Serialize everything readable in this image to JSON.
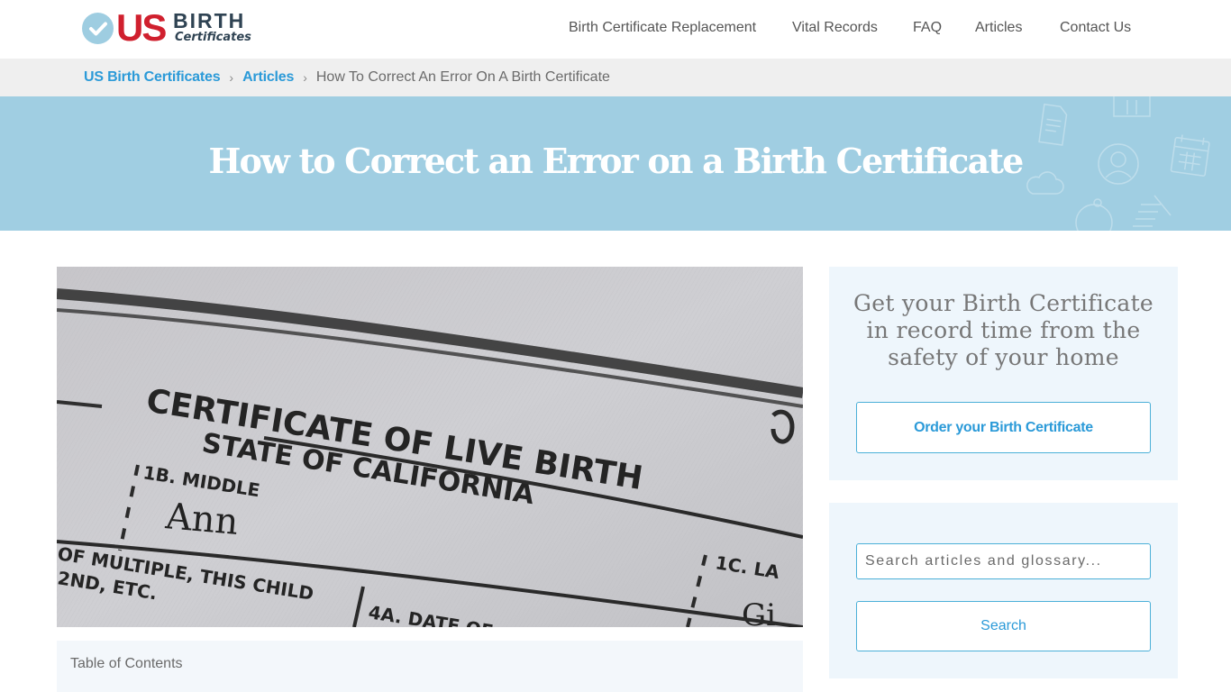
{
  "colors": {
    "brand_red": "#d0202e",
    "brand_navy": "#2f4353",
    "accent_blue": "#2b9ad8",
    "hero_bg": "#a0cee2",
    "breadcrumb_bg": "#efefef",
    "sidebar_bg": "#eef6fc"
  },
  "header": {
    "logo": {
      "mark_icon": "check-circle-icon",
      "us": "US",
      "birth": "BIRTH",
      "certificates": "Certificates"
    },
    "nav": [
      {
        "label": "Birth Certificate Replacement"
      },
      {
        "label": "Vital Records"
      },
      {
        "label": "FAQ"
      },
      {
        "label": "Articles"
      },
      {
        "label": "Contact Us"
      }
    ]
  },
  "breadcrumb": {
    "items": [
      {
        "label": "US Birth Certificates"
      },
      {
        "label": "Articles"
      }
    ],
    "separator": "›",
    "current": "How To Correct An Error On A Birth Certificate"
  },
  "hero": {
    "title": "How to Correct an Error on a Birth Certificate",
    "decor_icons": [
      "document-icon",
      "book-icon",
      "user-circle-icon",
      "calendar-icon",
      "cloud-icon",
      "stopwatch-icon",
      "checklist-icon"
    ]
  },
  "article": {
    "image": {
      "description": "Close-up of a California certificate of live birth",
      "text_lines": [
        "CERTIFICATE OF LIVE BIRTH",
        "STATE OF CALIFORNIA",
        "1B. MIDDLE",
        "Ann",
        "OF MULTIPLE, THIS CHILD",
        "2ND, ETC.",
        "4A. DATE OF",
        "1C. LA",
        "Gi"
      ]
    },
    "toc": {
      "title": "Table of Contents"
    }
  },
  "sidebar": {
    "cta": {
      "lines": [
        "Get your Birth Certificate",
        "in record time from the",
        "safety of your home"
      ],
      "button_label": "Order your Birth Certificate"
    },
    "search": {
      "placeholder": "Search articles and glossary...",
      "value": "",
      "button_label": "Search"
    }
  }
}
